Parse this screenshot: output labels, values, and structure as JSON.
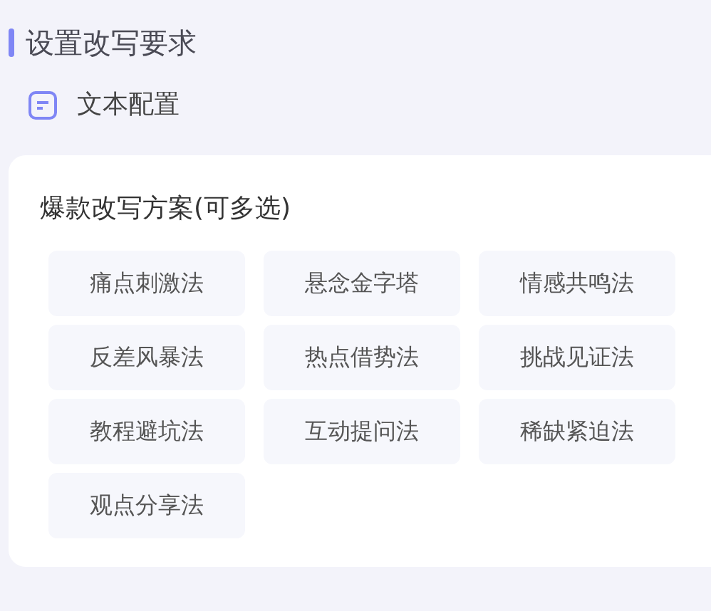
{
  "section_title": "设置改写要求",
  "tab": {
    "label": "文本配置"
  },
  "options_card": {
    "title": "爆款改写方案(可多选)",
    "options": [
      {
        "label": "痛点刺激法",
        "selected": false
      },
      {
        "label": "悬念金字塔",
        "selected": false
      },
      {
        "label": "情感共鸣法",
        "selected": false
      },
      {
        "label": "反差风暴法",
        "selected": false
      },
      {
        "label": "热点借势法",
        "selected": false
      },
      {
        "label": "挑战见证法",
        "selected": false
      },
      {
        "label": "教程避坑法",
        "selected": false
      },
      {
        "label": "互动提问法",
        "selected": false
      },
      {
        "label": "稀缺紧迫法",
        "selected": false
      },
      {
        "label": "观点分享法",
        "selected": false
      }
    ]
  }
}
